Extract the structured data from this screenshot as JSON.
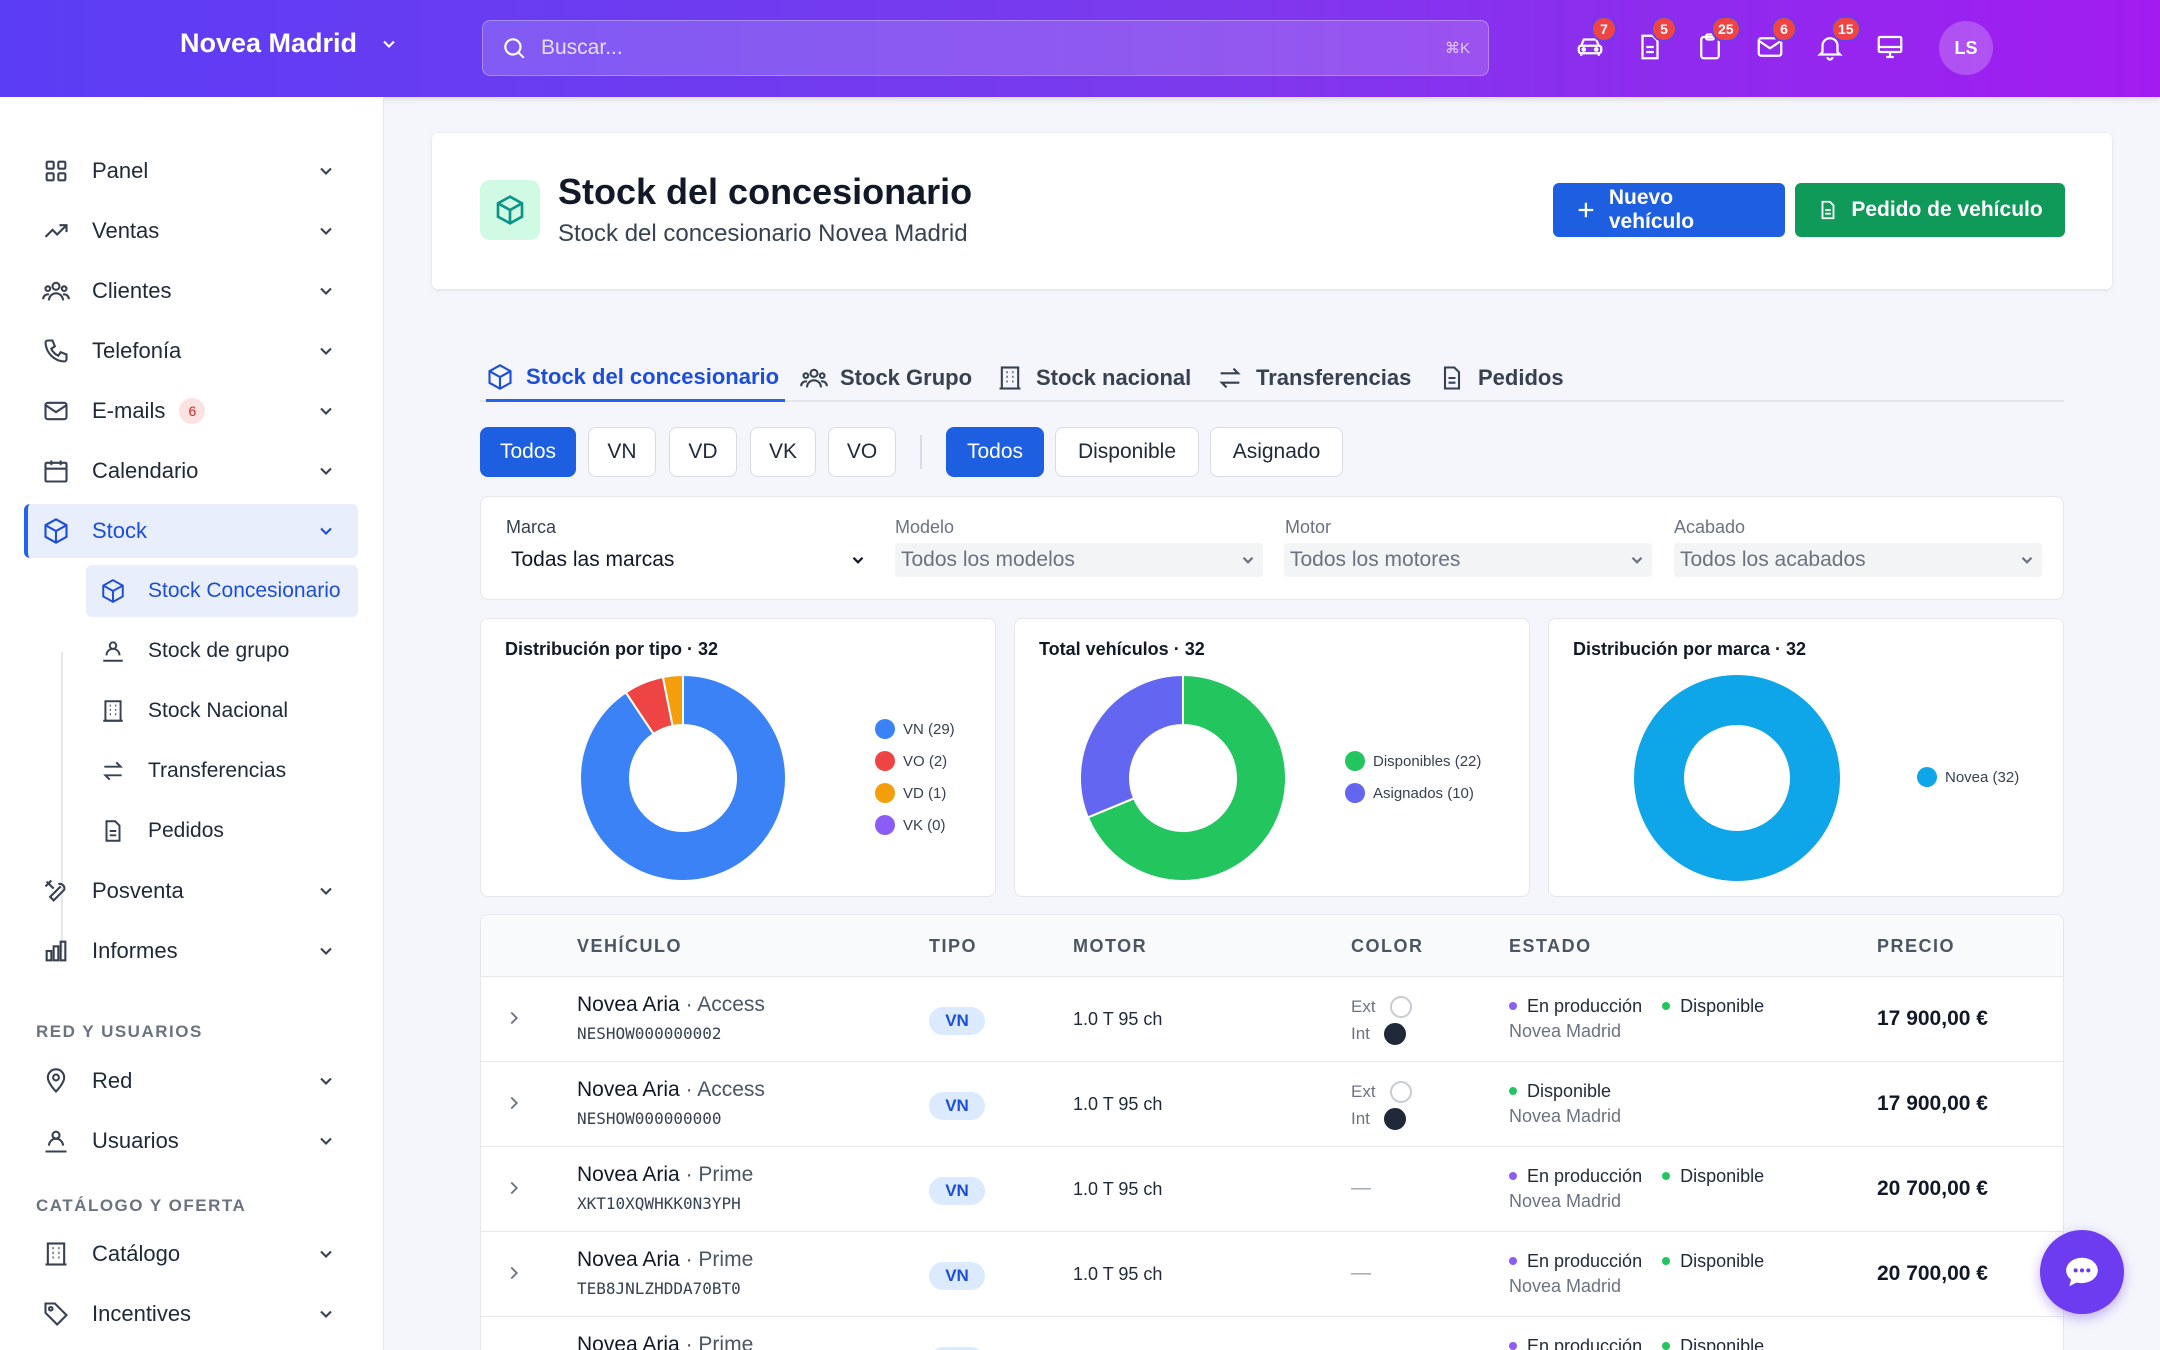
{
  "header": {
    "brand": "Novea Madrid",
    "search_placeholder": "Buscar...",
    "search_shortcut": "⌘K",
    "badges": {
      "car": "7",
      "doc": "5",
      "clipboard": "25",
      "mail": "6",
      "bell": "15"
    },
    "avatar": "LS"
  },
  "sidebar": {
    "items": [
      {
        "label": "Panel"
      },
      {
        "label": "Ventas"
      },
      {
        "label": "Clientes"
      },
      {
        "label": "Telefonía"
      },
      {
        "label": "E-mails",
        "badge": "6"
      },
      {
        "label": "Calendario"
      },
      {
        "label": "Stock"
      },
      {
        "label": "Posventa"
      },
      {
        "label": "Informes"
      }
    ],
    "subitems": [
      {
        "label": "Stock Concesionario"
      },
      {
        "label": "Stock de grupo"
      },
      {
        "label": "Stock Nacional"
      },
      {
        "label": "Transferencias"
      },
      {
        "label": "Pedidos"
      }
    ],
    "section1": "RED Y USUARIOS",
    "section1_items": [
      {
        "label": "Red"
      },
      {
        "label": "Usuarios"
      }
    ],
    "section2": "CATÁLOGO Y OFERTA",
    "section2_items": [
      {
        "label": "Catálogo"
      },
      {
        "label": "Incentives"
      }
    ]
  },
  "page": {
    "title": "Stock del concesionario",
    "subtitle": "Stock del concesionario Novea Madrid",
    "btn_new": "Nuevo vehículo",
    "btn_order": "Pedido de vehículo"
  },
  "tabs": [
    {
      "label": "Stock del concesionario"
    },
    {
      "label": "Stock Grupo"
    },
    {
      "label": "Stock nacional"
    },
    {
      "label": "Transferencias"
    },
    {
      "label": "Pedidos"
    }
  ],
  "type_filters": [
    "Todos",
    "VN",
    "VD",
    "VK",
    "VO"
  ],
  "status_filters": [
    "Todos",
    "Disponible",
    "Asignado"
  ],
  "filters": {
    "marca": {
      "label": "Marca",
      "value": "Todas las marcas"
    },
    "modelo": {
      "label": "Modelo",
      "value": "Todos los modelos"
    },
    "motor": {
      "label": "Motor",
      "value": "Todos los motores"
    },
    "acabado": {
      "label": "Acabado",
      "value": "Todos los acabados"
    }
  },
  "chart_data": [
    {
      "type": "pie",
      "title": "Distribución por tipo · 32",
      "categories": [
        "VN (29)",
        "VO (2)",
        "VD (1)",
        "VK (0)"
      ],
      "values": [
        29,
        2,
        1,
        0
      ],
      "colors": [
        "#3b82f6",
        "#ef4444",
        "#f59e0b",
        "#8b5cf6"
      ]
    },
    {
      "type": "pie",
      "title": "Total vehículos · 32",
      "categories": [
        "Disponibles (22)",
        "Asignados (10)"
      ],
      "values": [
        22,
        10
      ],
      "colors": [
        "#22c55e",
        "#6366f1"
      ]
    },
    {
      "type": "pie",
      "title": "Distribución por marca · 32",
      "categories": [
        "Novea (32)"
      ],
      "values": [
        32
      ],
      "colors": [
        "#0ea5e9"
      ]
    }
  ],
  "table": {
    "headers": {
      "vehiculo": "VEHÍCULO",
      "tipo": "TIPO",
      "motor": "MOTOR",
      "color": "COLOR",
      "estado": "ESTADO",
      "precio": "PRECIO"
    },
    "ext_label": "Ext",
    "int_label": "Int",
    "rows": [
      {
        "model": "Novea Aria",
        "trim": "· Access",
        "vin": "NESHOW000000002",
        "tipo": "VN",
        "motor": "1.0 T 95 ch",
        "color": true,
        "ext": "#ffffff",
        "int": "#1f2937",
        "estado1": "En producción",
        "estado2": "Disponible",
        "location": "Novea Madrid",
        "precio": "17 900,00 €"
      },
      {
        "model": "Novea Aria",
        "trim": "· Access",
        "vin": "NESHOW000000000",
        "tipo": "VN",
        "motor": "1.0 T 95 ch",
        "color": true,
        "ext": "#ffffff",
        "int": "#1f2937",
        "estado1": "",
        "estado2": "Disponible",
        "location": "Novea Madrid",
        "precio": "17 900,00 €"
      },
      {
        "model": "Novea Aria",
        "trim": "· Prime",
        "vin": "XKT10XQWHKK0N3YPH",
        "tipo": "VN",
        "motor": "1.0 T 95 ch",
        "color": false,
        "dash": "—",
        "estado1": "En producción",
        "estado2": "Disponible",
        "location": "Novea Madrid",
        "precio": "20 700,00 €"
      },
      {
        "model": "Novea Aria",
        "trim": "· Prime",
        "vin": "TEB8JNLZHDDA70BT0",
        "tipo": "VN",
        "motor": "1.0 T 95 ch",
        "color": false,
        "dash": "—",
        "estado1": "En producción",
        "estado2": "Disponible",
        "location": "Novea Madrid",
        "precio": "20 700,00 €"
      },
      {
        "model": "Novea Aria",
        "trim": "· Prime",
        "vin": "",
        "tipo": "VN",
        "motor": "",
        "color": false,
        "dash": "",
        "estado1": "En producción",
        "estado2": "Disponible",
        "location": "",
        "precio": ""
      }
    ]
  }
}
